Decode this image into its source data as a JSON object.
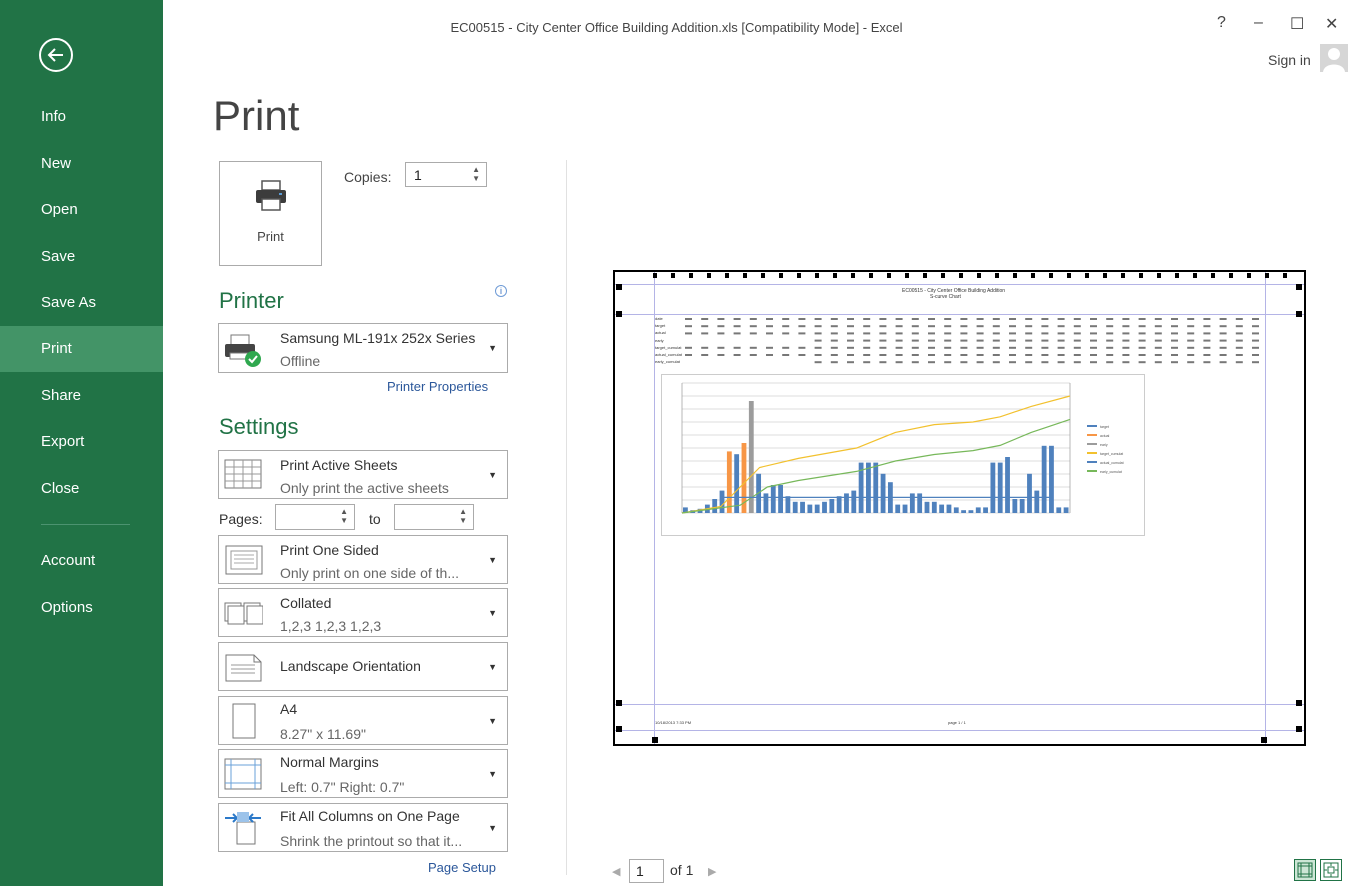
{
  "window": {
    "title": "EC00515 - City Center Office Building Addition.xls  [Compatibility Mode] - Excel",
    "help": "?",
    "minimize": "–",
    "maximize": "☐",
    "close": "✕",
    "sign_in": "Sign in"
  },
  "sidebar": {
    "items": [
      {
        "label": "Info"
      },
      {
        "label": "New"
      },
      {
        "label": "Open"
      },
      {
        "label": "Save"
      },
      {
        "label": "Save As"
      },
      {
        "label": "Print"
      },
      {
        "label": "Share"
      },
      {
        "label": "Export"
      },
      {
        "label": "Close"
      },
      {
        "label": "Account"
      },
      {
        "label": "Options"
      }
    ],
    "active": "Print"
  },
  "print": {
    "page_title": "Print",
    "button_label": "Print",
    "copies_label": "Copies:",
    "copies_value": "1",
    "printer_heading": "Printer",
    "printer_name": "Samsung ML-191x 252x Series",
    "printer_status": "Offline",
    "printer_properties": "Printer Properties",
    "settings_heading": "Settings",
    "settings": [
      {
        "title": "Print Active Sheets",
        "subtitle": "Only print the active sheets"
      },
      {
        "title": "Print One Sided",
        "subtitle": "Only print on one side of th..."
      },
      {
        "title": "Collated",
        "subtitle": "1,2,3    1,2,3    1,2,3"
      },
      {
        "title": "Landscape Orientation",
        "subtitle": ""
      },
      {
        "title": "A4",
        "subtitle": "8.27\" x 11.69\""
      },
      {
        "title": "Normal Margins",
        "subtitle": "Left:  0.7\"    Right:  0.7\""
      },
      {
        "title": "Fit All Columns on One Page",
        "subtitle": "Shrink the printout so that it..."
      }
    ],
    "pages_label": "Pages:",
    "to_label": "to",
    "page_setup": "Page Setup"
  },
  "preview": {
    "sheet_title": "EC00515 - City Center Office Building Addition",
    "sheet_subtitle": "S-curve Chart",
    "footer_date": "10/18/2013  7:33 PM",
    "footer_page": "page  1 / 1",
    "row_labels": [
      "date",
      "target",
      "actual",
      "early",
      "target_cumulat",
      "actual_cumulat",
      "early_cumulat"
    ],
    "legend": [
      "target",
      "actual",
      "early",
      "target_cumulat",
      "actual_cumulat",
      "early_cumulat"
    ],
    "colors": {
      "target": "#4f81bd",
      "actual": "#f79646",
      "early": "#9c9c9c",
      "target_cumulat": "#f2c12e",
      "actual_cumulat": "#4f81bd",
      "early_cumulat": "#77b85a"
    }
  },
  "pager": {
    "current": "1",
    "of_label": "of 1"
  },
  "colors": {
    "brand": "#217346",
    "sidebar_active": "#439467",
    "link": "#2b579a"
  }
}
